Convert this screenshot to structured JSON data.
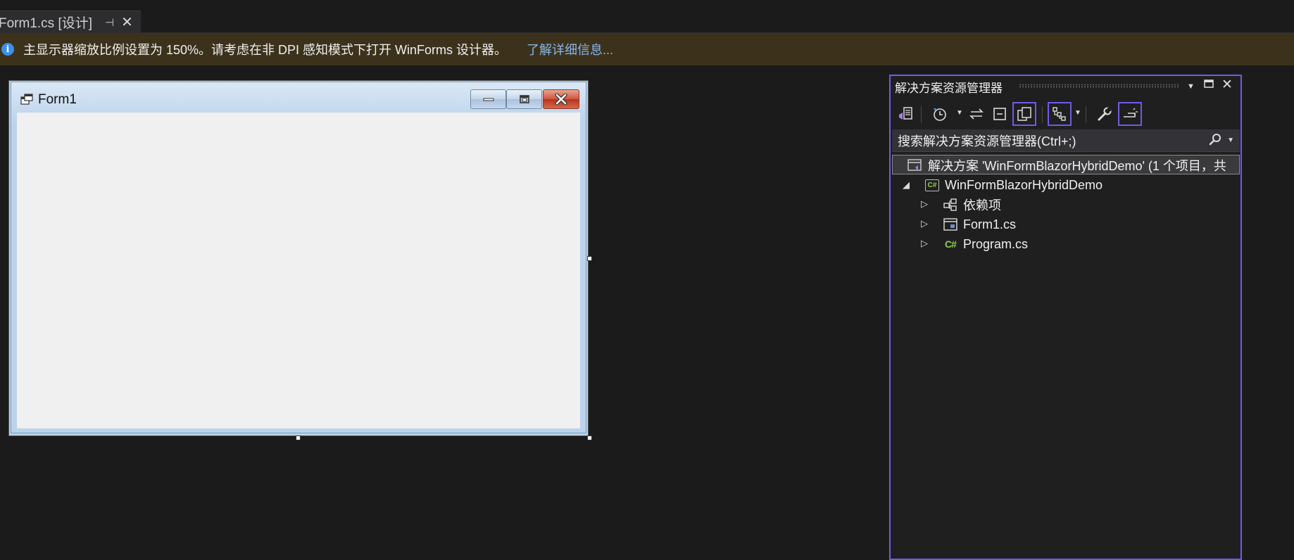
{
  "document_tab": {
    "title": "Form1.cs [设计]",
    "pin_icon": "pin-icon",
    "close_icon": "close-icon"
  },
  "info_bar": {
    "icon": "info-icon",
    "message": "主显示器缩放比例设置为 150%。请考虑在非 DPI 感知模式下打开 WinForms 设计器。",
    "link": "了解详细信息..."
  },
  "designer": {
    "form_title": "Form1",
    "caption_buttons": [
      "minimize-icon",
      "maximize-icon",
      "close-icon"
    ]
  },
  "solution_explorer": {
    "title": "解决方案资源管理器",
    "search_placeholder": "搜索解决方案资源管理器(Ctrl+;)",
    "accent_color": "#6c5ce7",
    "toolbar_icons": [
      "switch-views-icon",
      "pending-changes-icon",
      "sync-icon",
      "collapse-all-icon",
      "show-all-files-icon",
      "tree-filter-icon",
      "properties-icon",
      "preview-icon"
    ],
    "tree": {
      "solution": "解决方案 'WinFormBlazorHybridDemo' (1 个项目，共",
      "project": "WinFormBlazorHybridDemo",
      "items": [
        {
          "label": "依赖项",
          "icon": "dependencies-icon"
        },
        {
          "label": "Form1.cs",
          "icon": "form-icon"
        },
        {
          "label": "Program.cs",
          "icon": "csharp-file-icon"
        }
      ],
      "csharp_glyph": "C#"
    }
  }
}
